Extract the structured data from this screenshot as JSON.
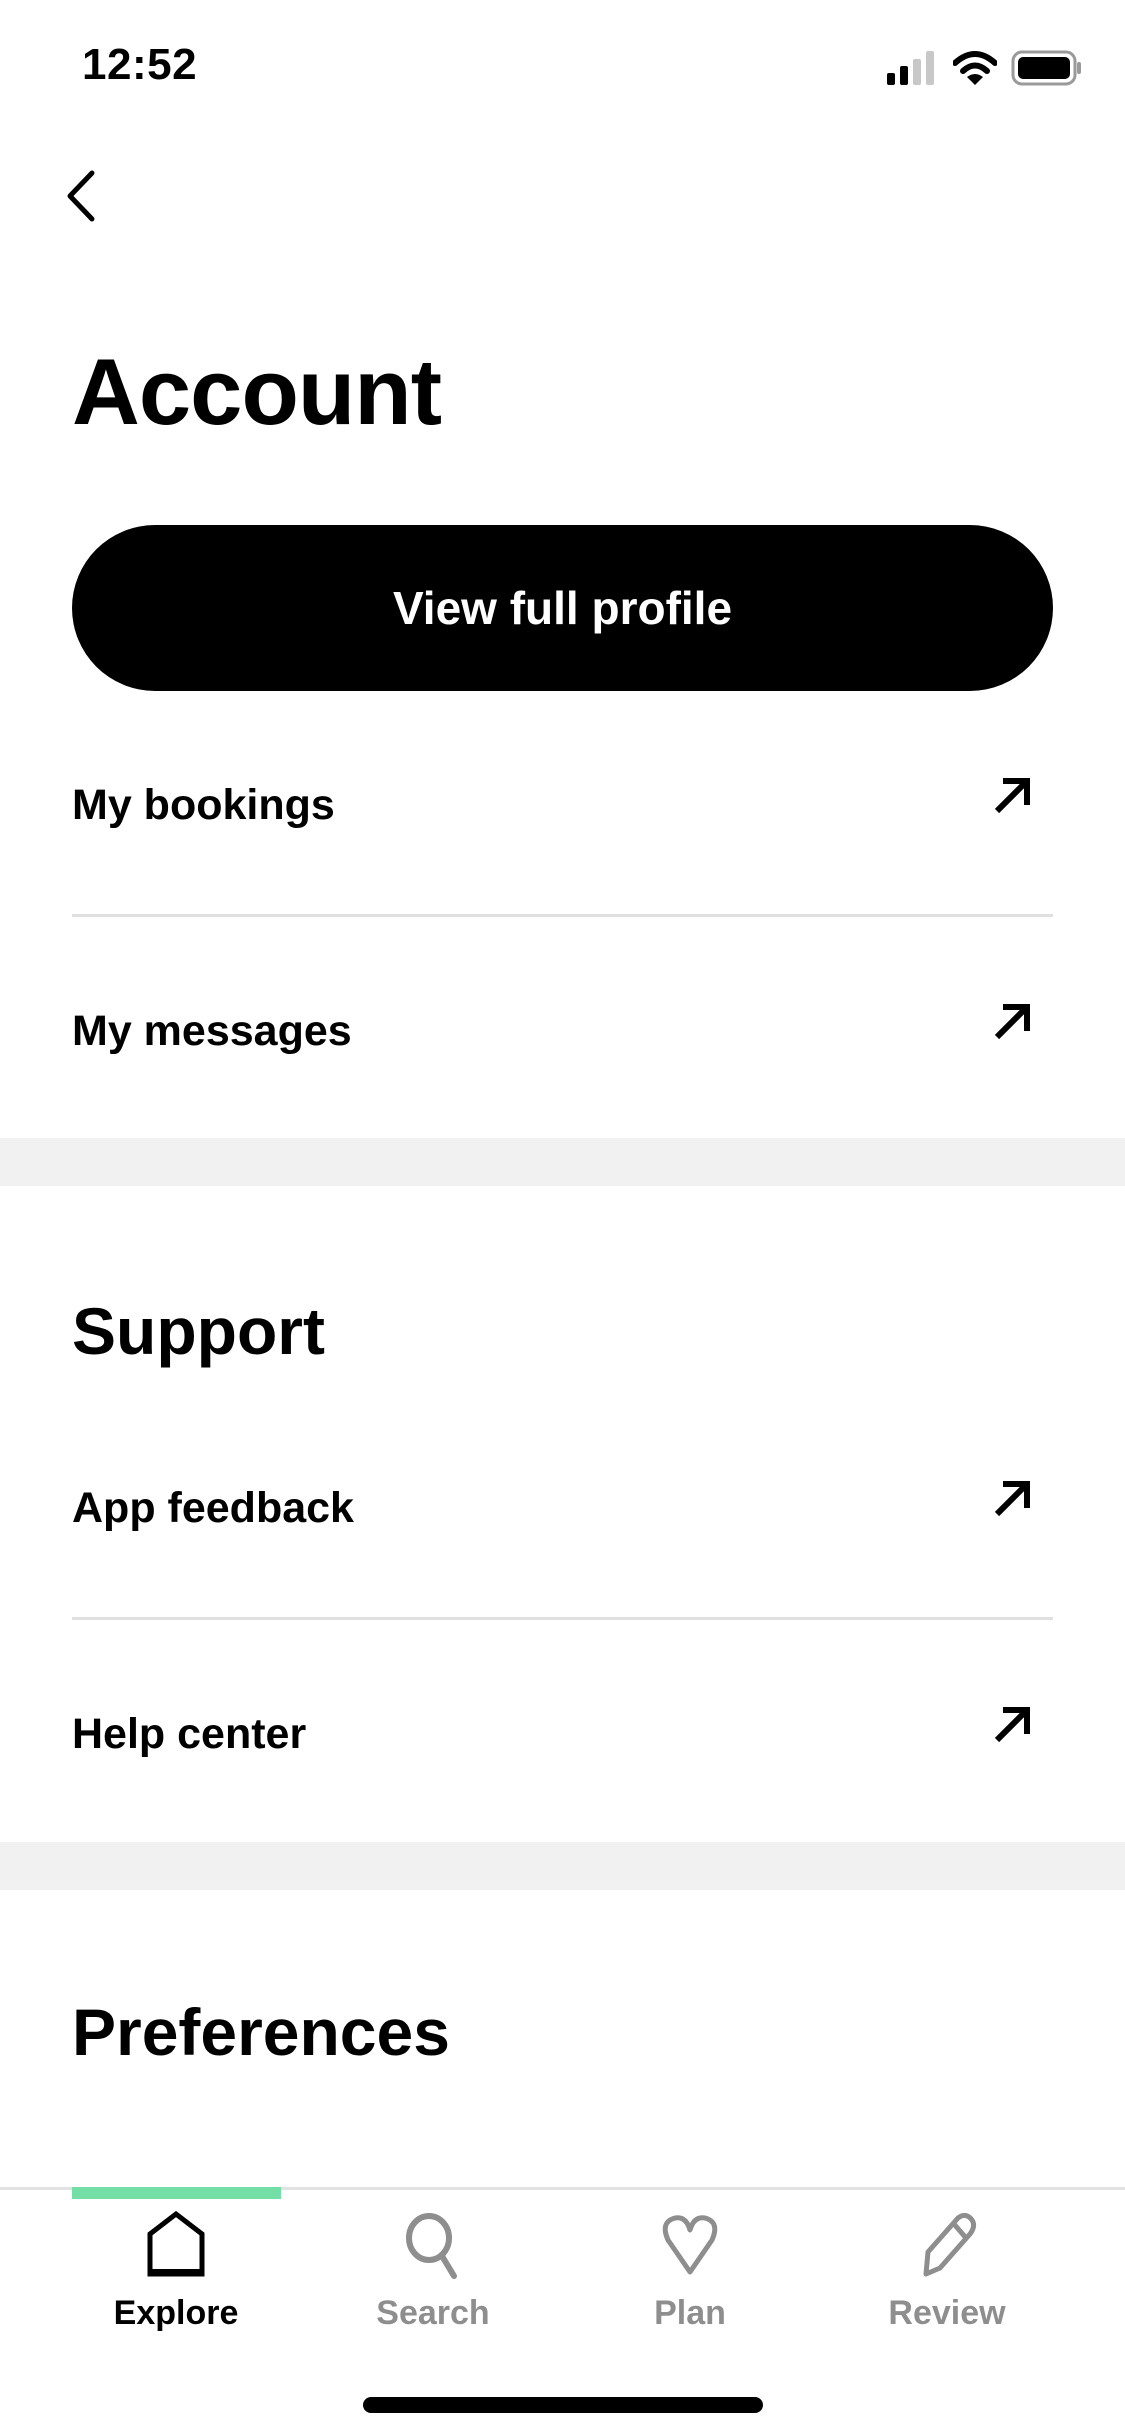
{
  "status_bar": {
    "time": "12:52",
    "signal_bars_active": 2,
    "signal_bars_total": 4
  },
  "header": {
    "back_icon": "chevron-left-icon",
    "title": "Account"
  },
  "profile_button": {
    "label": "View full profile"
  },
  "account_items": [
    {
      "label": "My bookings",
      "icon": "arrow-up-right-icon"
    },
    {
      "label": "My messages",
      "icon": "arrow-up-right-icon"
    }
  ],
  "support": {
    "title": "Support",
    "items": [
      {
        "label": "App feedback",
        "icon": "arrow-up-right-icon"
      },
      {
        "label": "Help center",
        "icon": "arrow-up-right-icon"
      }
    ]
  },
  "preferences": {
    "title": "Preferences"
  },
  "tabbar": {
    "accent_color": "#73dea6",
    "tabs": [
      {
        "label": "Explore",
        "icon": "home-icon",
        "active": true
      },
      {
        "label": "Search",
        "icon": "search-icon",
        "active": false
      },
      {
        "label": "Plan",
        "icon": "heart-icon",
        "active": false
      },
      {
        "label": "Review",
        "icon": "pencil-icon",
        "active": false
      }
    ]
  }
}
